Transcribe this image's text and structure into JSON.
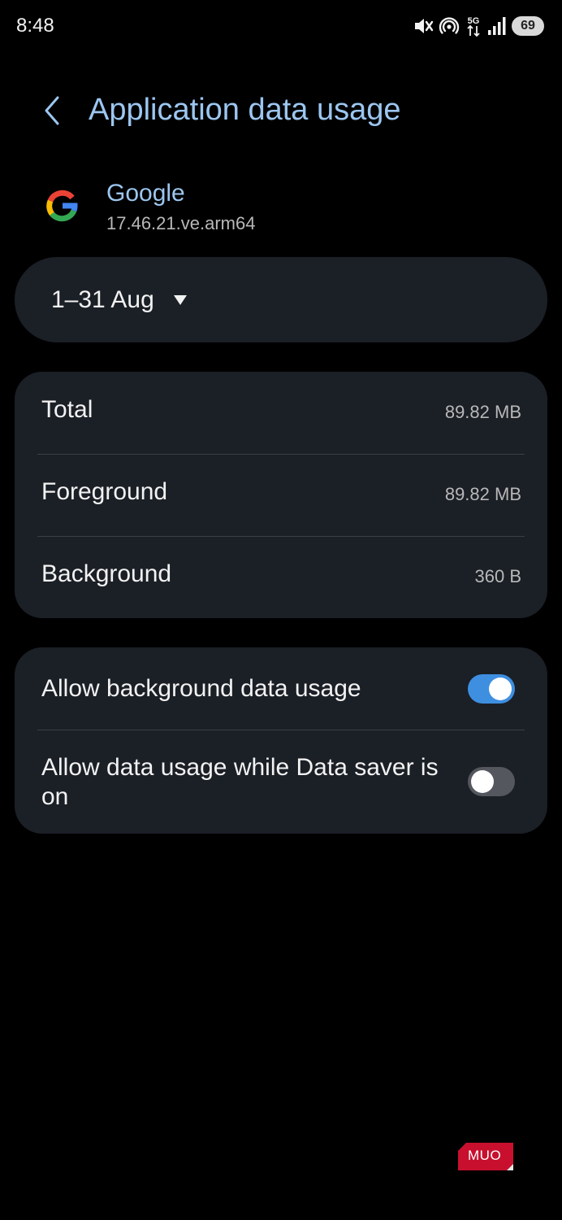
{
  "status_bar": {
    "time": "8:48",
    "network": "5G",
    "battery": "69",
    "icons": [
      "mute-icon",
      "hotspot-icon",
      "mobile-data-icon",
      "signal-icon",
      "battery-icon"
    ]
  },
  "header": {
    "title": "Application data usage",
    "back_icon": "chevron-left-icon"
  },
  "app": {
    "name": "Google",
    "version": "17.46.21.ve.arm64",
    "logo_icon": "google-logo-icon"
  },
  "date_range": {
    "label": "1–31 Aug",
    "icon": "dropdown-arrow-icon"
  },
  "usage": {
    "rows": [
      {
        "label": "Total",
        "value": "89.82 MB"
      },
      {
        "label": "Foreground",
        "value": "89.82 MB"
      },
      {
        "label": "Background",
        "value": "360 B"
      }
    ]
  },
  "settings": {
    "items": [
      {
        "label": "Allow background data usage",
        "enabled": true
      },
      {
        "label": "Allow data usage while Data saver is on",
        "enabled": false
      }
    ]
  },
  "watermark": {
    "text": "MUO"
  },
  "colors": {
    "background": "#000000",
    "card": "#1b1f26",
    "accent_text": "#9cc6f0",
    "toggle_on": "#3e8fe0",
    "toggle_off": "#54575d",
    "watermark": "#c8102e"
  }
}
